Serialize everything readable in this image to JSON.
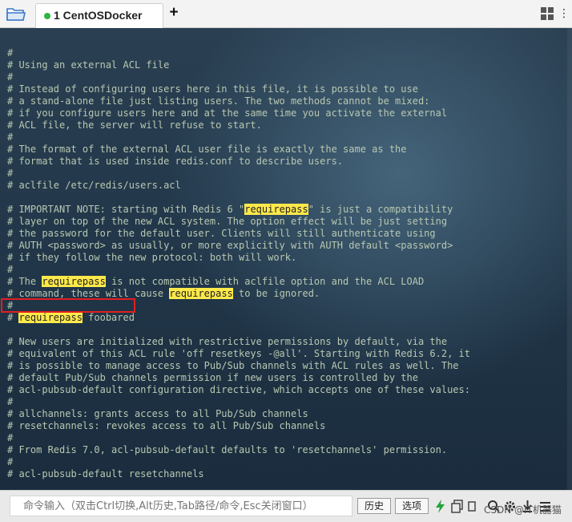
{
  "tabbar": {
    "tab_label": "1 CentOSDocker",
    "new_tab_label": "+",
    "icons": [
      "folder-icon",
      "dot-icon",
      "grid-icon",
      "more-icon"
    ],
    "status_color": "#2fb344"
  },
  "terminal": {
    "lines": [
      [
        {
          "t": "#"
        }
      ],
      [
        {
          "t": "# Using an external ACL file"
        }
      ],
      [
        {
          "t": "#"
        }
      ],
      [
        {
          "t": "# Instead of configuring users here in this file, it is possible to use"
        }
      ],
      [
        {
          "t": "# a stand-alone file just listing users. The two methods cannot be mixed:"
        }
      ],
      [
        {
          "t": "# if you configure users here and at the same time you activate the external"
        }
      ],
      [
        {
          "t": "# ACL file, the server will refuse to start."
        }
      ],
      [
        {
          "t": "#"
        }
      ],
      [
        {
          "t": "# The format of the external ACL user file is exactly the same as the"
        }
      ],
      [
        {
          "t": "# format that is used inside redis.conf to describe users."
        }
      ],
      [
        {
          "t": "#"
        }
      ],
      [
        {
          "t": "# aclfile /etc/redis/users.acl"
        }
      ],
      [
        {
          "t": ""
        }
      ],
      [
        {
          "t": "# IMPORTANT NOTE: starting with Redis 6 \""
        },
        {
          "t": "requirepass",
          "h": true
        },
        {
          "t": "\" is just a compatibility"
        }
      ],
      [
        {
          "t": "# layer on top of the new ACL system. The option effect will be just setting"
        }
      ],
      [
        {
          "t": "# the password for the default user. Clients will still authenticate using"
        }
      ],
      [
        {
          "t": "# AUTH <password> as usually, or more explicitly with AUTH default <password>"
        }
      ],
      [
        {
          "t": "# if they follow the new protocol: both will work."
        }
      ],
      [
        {
          "t": "#"
        }
      ],
      [
        {
          "t": "# The "
        },
        {
          "t": "requirepass",
          "h": true
        },
        {
          "t": " is not compatible with aclfile option and the ACL LOAD"
        }
      ],
      [
        {
          "t": "# command, these will cause "
        },
        {
          "t": "requirepass",
          "h": true
        },
        {
          "t": " to be ignored."
        }
      ],
      [
        {
          "t": "#"
        }
      ],
      [
        {
          "t": "# "
        },
        {
          "t": "requirepass",
          "h": true
        },
        {
          "t": " foobared"
        }
      ],
      [
        {
          "t": ""
        }
      ],
      [
        {
          "t": "# New users are initialized with restrictive permissions by default, via the"
        }
      ],
      [
        {
          "t": "# equivalent of this ACL rule 'off resetkeys -@all'. Starting with Redis 6.2, it"
        }
      ],
      [
        {
          "t": "# is possible to manage access to Pub/Sub channels with ACL rules as well. The"
        }
      ],
      [
        {
          "t": "# default Pub/Sub channels permission if new users is controlled by the"
        }
      ],
      [
        {
          "t": "# acl-pubsub-default configuration directive, which accepts one of these values:"
        }
      ],
      [
        {
          "t": "#"
        }
      ],
      [
        {
          "t": "# allchannels: grants access to all Pub/Sub channels"
        }
      ],
      [
        {
          "t": "# resetchannels: revokes access to all Pub/Sub channels"
        }
      ],
      [
        {
          "t": "#"
        }
      ],
      [
        {
          "t": "# From Redis 7.0, acl-pubsub-default defaults to 'resetchannels' permission."
        }
      ],
      [
        {
          "t": "#"
        }
      ],
      [
        {
          "t": "# acl-pubsub-default resetchannels"
        }
      ]
    ],
    "text_color": "#b9c8b1",
    "highlight_color": "#ffe94a",
    "selection_box_color": "#e02020"
  },
  "command_bar": {
    "input_placeholder": "命令输入（双击Ctrl切换,Alt历史,Tab路径/命令,Esc关闭窗口）",
    "history_button": "历史",
    "options_button": "选项",
    "icons": [
      "lightning-icon",
      "copy-icon",
      "search-icon",
      "gear-icon",
      "download-icon",
      "menu-icon"
    ],
    "watermark": "CSDN @IT机器猫"
  }
}
